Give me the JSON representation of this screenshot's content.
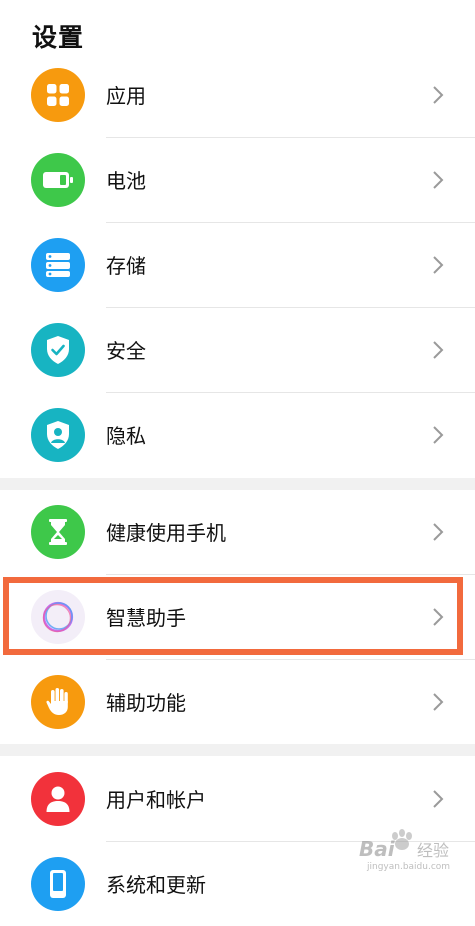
{
  "header": {
    "title": "设置"
  },
  "items": [
    {
      "label": "应用",
      "icon": "apps-grid-icon",
      "color": "#f79a0e"
    },
    {
      "label": "电池",
      "icon": "battery-icon",
      "color": "#3ec84a"
    },
    {
      "label": "存储",
      "icon": "storage-icon",
      "color": "#1e9ff2"
    },
    {
      "label": "安全",
      "icon": "shield-check-icon",
      "color": "#17b4c2"
    },
    {
      "label": "隐私",
      "icon": "privacy-shield-icon",
      "color": "#17b4c2"
    },
    {
      "label": "健康使用手机",
      "icon": "hourglass-icon",
      "color": "#3ec84a"
    },
    {
      "label": "智慧助手",
      "icon": "smart-assistant-icon",
      "color": "#f3eef8"
    },
    {
      "label": "辅助功能",
      "icon": "hand-icon",
      "color": "#f79a0e"
    },
    {
      "label": "用户和帐户",
      "icon": "user-icon",
      "color": "#f2323b"
    },
    {
      "label": "系统和更新",
      "icon": "phone-icon",
      "color": "#1e9ff2"
    }
  ],
  "highlight_color": "#f26a3d",
  "watermark": {
    "text": "Bai 经验",
    "subtext": "jingyan.baidu.com"
  }
}
